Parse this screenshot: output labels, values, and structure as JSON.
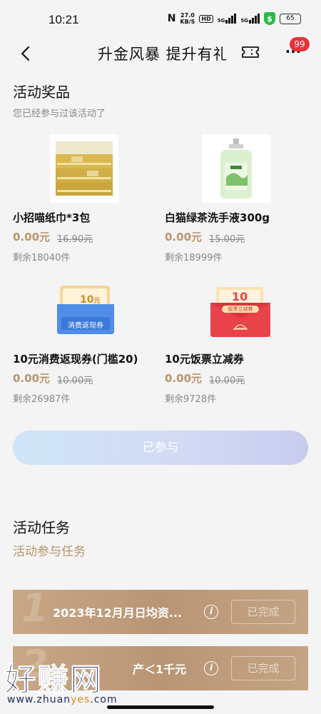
{
  "status_bar": {
    "time": "10:21",
    "nfc": "N",
    "speed_value": "27.0",
    "speed_unit": "KB/S",
    "hd": "HD",
    "net1": "5G",
    "net2": "5G",
    "shield": "$",
    "battery": "65"
  },
  "header": {
    "title": "升金风暴 提升有礼",
    "badge": "99",
    "more": "···"
  },
  "prizes_section": {
    "title": "活动奖品",
    "subtitle": "您已经参与过该活动了",
    "items": [
      {
        "name": "小招喵纸巾*3包",
        "price": "0.00元",
        "original": "16.90元",
        "remaining": "剩余18040件"
      },
      {
        "name": "白猫绿茶洗手液300g",
        "price": "0.00元",
        "original": "15.00元",
        "remaining": "剩余18999件"
      },
      {
        "name": "10元消费返现券(门槛20)",
        "price": "0.00元",
        "original": "10.00元",
        "remaining": "剩余26987件",
        "coupon_amount": "10",
        "coupon_unit": "元",
        "coupon_label": "消费返现券"
      },
      {
        "name": "10元饭票立减券",
        "price": "0.00元",
        "original": "10.00元",
        "remaining": "剩余9728件",
        "coupon_amount": "10",
        "coupon_label": "饭票立减券"
      }
    ]
  },
  "joined_button": "已参与",
  "tasks_section": {
    "title": "活动任务",
    "subtitle": "活动参与任务",
    "tasks": [
      {
        "num": "1",
        "text": "2023年12月月日均资...",
        "status": "已完成"
      },
      {
        "num": "2",
        "text": "产＜1千元",
        "status": "已完成"
      }
    ]
  },
  "watermark": {
    "big": "好赚网",
    "url_part1": "www.zhuan",
    "url_accent": "yes",
    "url_part2": ".com"
  },
  "colors": {
    "accent_gold": "#b8956a",
    "badge_red": "#e8323a",
    "task_card": "#c4a484"
  }
}
